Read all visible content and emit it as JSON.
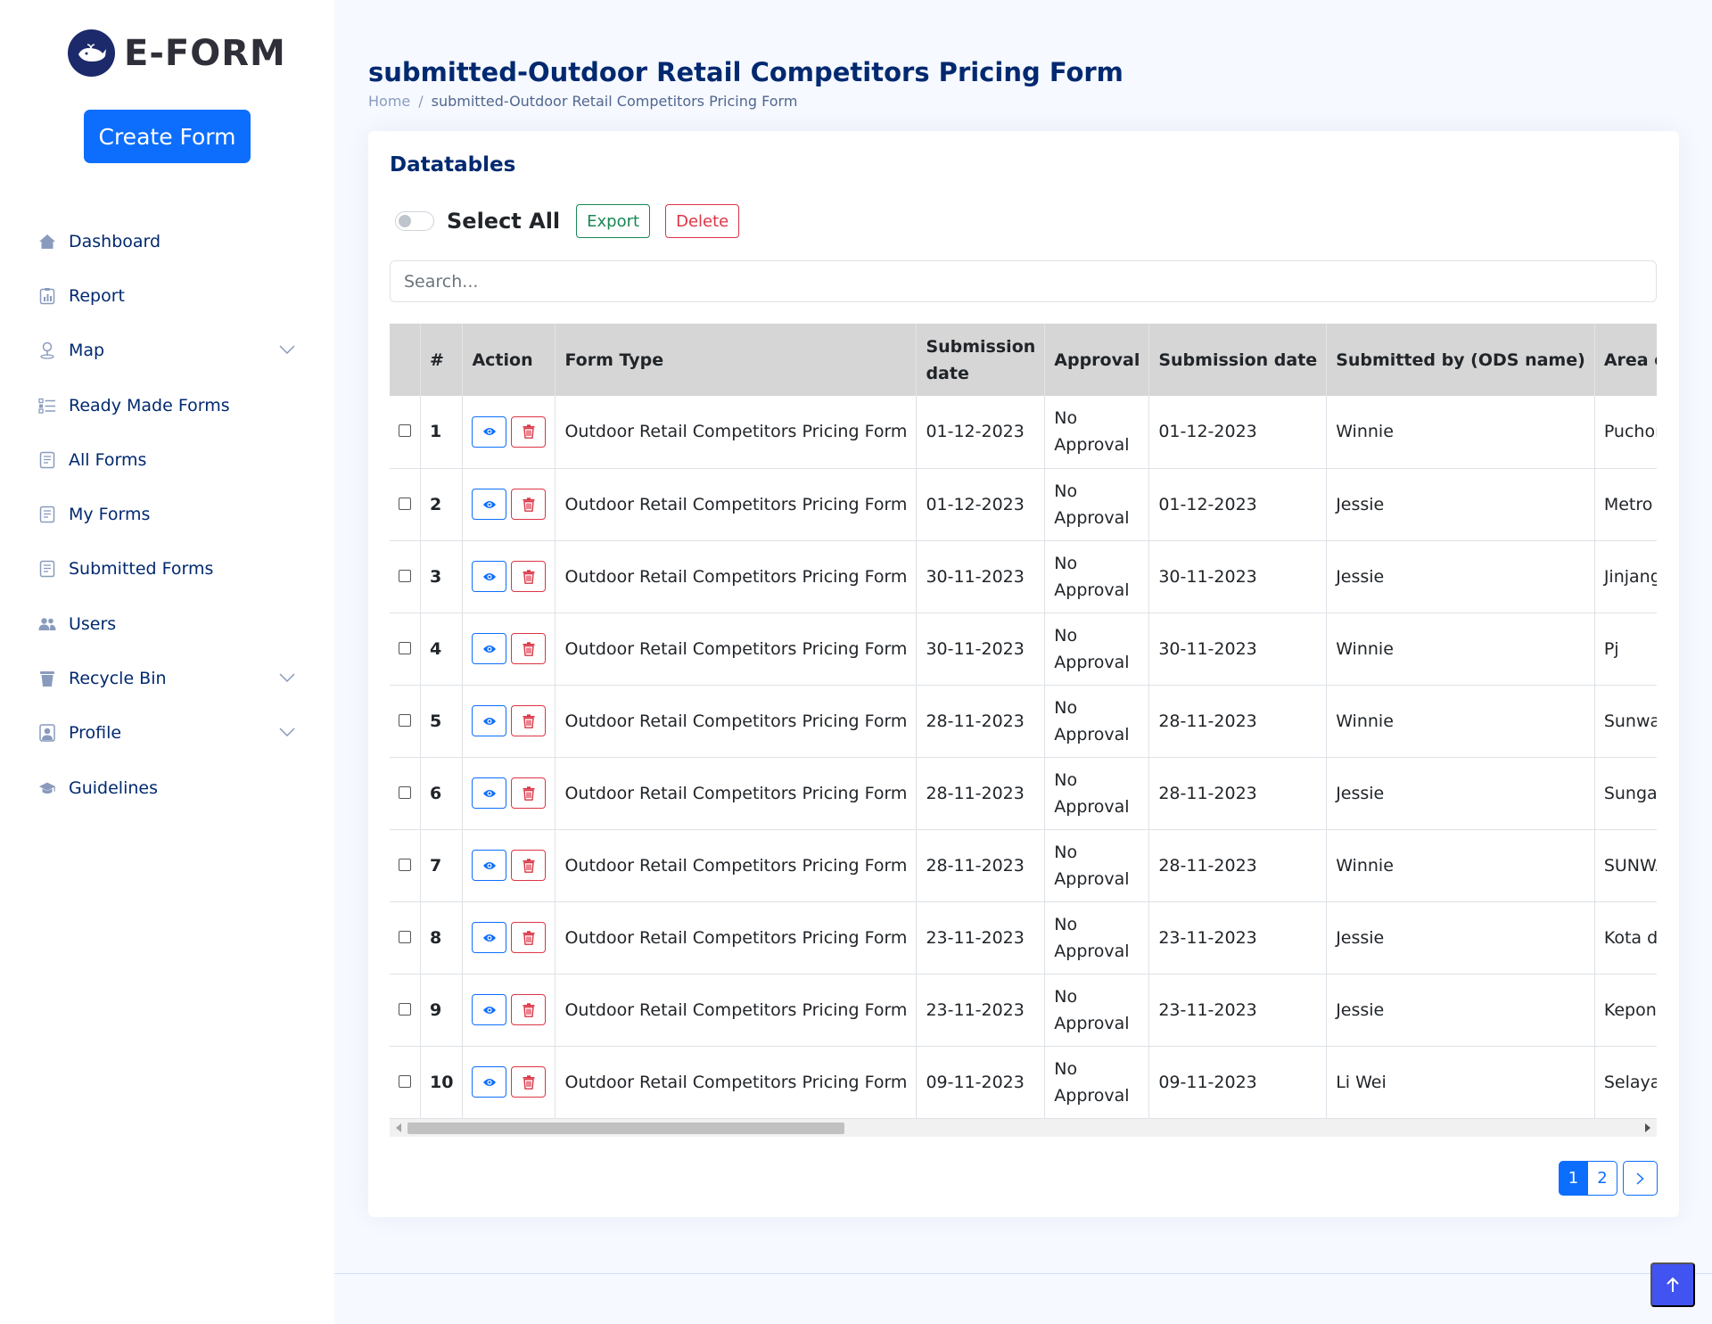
{
  "app": {
    "logo_text": "E-FORM",
    "create_button": "Create Form"
  },
  "sidebar": {
    "items": [
      {
        "label": "Dashboard",
        "icon": "house-icon"
      },
      {
        "label": "Report",
        "icon": "report-icon"
      },
      {
        "label": "Map",
        "icon": "map-pin-icon",
        "expandable": true
      },
      {
        "label": "Ready Made Forms",
        "icon": "list-icon"
      },
      {
        "label": "All Forms",
        "icon": "document-icon"
      },
      {
        "label": "My Forms",
        "icon": "document-icon"
      },
      {
        "label": "Submitted Forms",
        "icon": "document-icon"
      },
      {
        "label": "Users",
        "icon": "users-icon"
      },
      {
        "label": "Recycle Bin",
        "icon": "trash-icon",
        "expandable": true
      },
      {
        "label": "Profile",
        "icon": "person-icon",
        "expandable": true
      },
      {
        "label": "Guidelines",
        "icon": "graduation-cap-icon"
      }
    ]
  },
  "page": {
    "title": "submitted-Outdoor Retail Competitors Pricing Form",
    "breadcrumb_home": "Home",
    "breadcrumb_sep": "/",
    "breadcrumb_current": "submitted-Outdoor Retail Competitors Pricing Form"
  },
  "card": {
    "title": "Datatables",
    "select_all": "Select All",
    "export": "Export",
    "delete": "Delete",
    "search_placeholder": "Search..."
  },
  "table": {
    "headers": [
      "#",
      "Action",
      "Form Type",
      "Submission date",
      "Approval",
      "Submission date",
      "Submitted by (ODS name)",
      "Area of survey"
    ],
    "rows": [
      {
        "num": "1",
        "form_type": "Outdoor Retail Competitors Pricing Form",
        "date1": "01-12-2023",
        "approval": "No Approval",
        "date2": "01-12-2023",
        "by": "Winnie",
        "area": "Puchong"
      },
      {
        "num": "2",
        "form_type": "Outdoor Retail Competitors Pricing Form",
        "date1": "01-12-2023",
        "approval": "No Approval",
        "date2": "01-12-2023",
        "by": "Jessie",
        "area": "Metro prima"
      },
      {
        "num": "3",
        "form_type": "Outdoor Retail Competitors Pricing Form",
        "date1": "30-11-2023",
        "approval": "No Approval",
        "date2": "30-11-2023",
        "by": "Jessie",
        "area": "Jinjang"
      },
      {
        "num": "4",
        "form_type": "Outdoor Retail Competitors Pricing Form",
        "date1": "30-11-2023",
        "approval": "No Approval",
        "date2": "30-11-2023",
        "by": "Winnie",
        "area": "Pj"
      },
      {
        "num": "5",
        "form_type": "Outdoor Retail Competitors Pricing Form",
        "date1": "28-11-2023",
        "approval": "No Approval",
        "date2": "28-11-2023",
        "by": "Winnie",
        "area": "Sunway"
      },
      {
        "num": "6",
        "form_type": "Outdoor Retail Competitors Pricing Form",
        "date1": "28-11-2023",
        "approval": "No Approval",
        "date2": "28-11-2023",
        "by": "Jessie",
        "area": "Sungai buloh"
      },
      {
        "num": "7",
        "form_type": "Outdoor Retail Competitors Pricing Form",
        "date1": "28-11-2023",
        "approval": "No Approval",
        "date2": "28-11-2023",
        "by": "Winnie",
        "area": "SUNWAY"
      },
      {
        "num": "8",
        "form_type": "Outdoor Retail Competitors Pricing Form",
        "date1": "23-11-2023",
        "approval": "No Approval",
        "date2": "23-11-2023",
        "by": "Jessie",
        "area": "Kota damansara"
      },
      {
        "num": "9",
        "form_type": "Outdoor Retail Competitors Pricing Form",
        "date1": "23-11-2023",
        "approval": "No Approval",
        "date2": "23-11-2023",
        "by": "Jessie",
        "area": "Kepong puncak"
      },
      {
        "num": "10",
        "form_type": "Outdoor Retail Competitors Pricing Form",
        "date1": "09-11-2023",
        "approval": "No Approval",
        "date2": "09-11-2023",
        "by": "Li Wei",
        "area": "Selayang"
      }
    ]
  },
  "pagination": {
    "pages": [
      "1",
      "2"
    ],
    "current": "1"
  },
  "colors": {
    "primary": "#0d6efd",
    "nav_text": "#012970",
    "success": "#198754",
    "danger": "#dc3545",
    "back_to_top": "#4154f1"
  }
}
